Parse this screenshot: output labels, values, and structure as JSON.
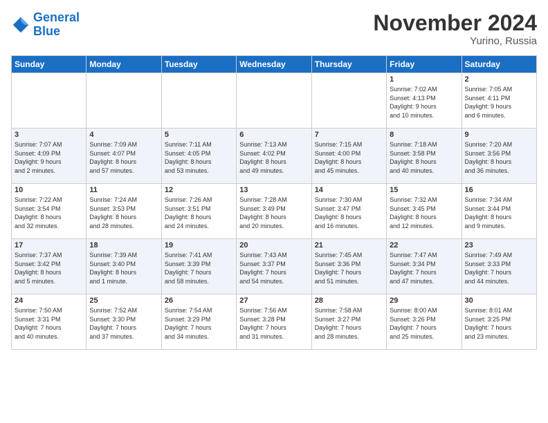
{
  "logo": {
    "line1": "General",
    "line2": "Blue"
  },
  "title": "November 2024",
  "location": "Yurino, Russia",
  "days_header": [
    "Sunday",
    "Monday",
    "Tuesday",
    "Wednesday",
    "Thursday",
    "Friday",
    "Saturday"
  ],
  "weeks": [
    [
      {
        "day": "",
        "info": ""
      },
      {
        "day": "",
        "info": ""
      },
      {
        "day": "",
        "info": ""
      },
      {
        "day": "",
        "info": ""
      },
      {
        "day": "",
        "info": ""
      },
      {
        "day": "1",
        "info": "Sunrise: 7:02 AM\nSunset: 4:13 PM\nDaylight: 9 hours\nand 10 minutes."
      },
      {
        "day": "2",
        "info": "Sunrise: 7:05 AM\nSunset: 4:11 PM\nDaylight: 9 hours\nand 6 minutes."
      }
    ],
    [
      {
        "day": "3",
        "info": "Sunrise: 7:07 AM\nSunset: 4:09 PM\nDaylight: 9 hours\nand 2 minutes."
      },
      {
        "day": "4",
        "info": "Sunrise: 7:09 AM\nSunset: 4:07 PM\nDaylight: 8 hours\nand 57 minutes."
      },
      {
        "day": "5",
        "info": "Sunrise: 7:11 AM\nSunset: 4:05 PM\nDaylight: 8 hours\nand 53 minutes."
      },
      {
        "day": "6",
        "info": "Sunrise: 7:13 AM\nSunset: 4:02 PM\nDaylight: 8 hours\nand 49 minutes."
      },
      {
        "day": "7",
        "info": "Sunrise: 7:15 AM\nSunset: 4:00 PM\nDaylight: 8 hours\nand 45 minutes."
      },
      {
        "day": "8",
        "info": "Sunrise: 7:18 AM\nSunset: 3:58 PM\nDaylight: 8 hours\nand 40 minutes."
      },
      {
        "day": "9",
        "info": "Sunrise: 7:20 AM\nSunset: 3:56 PM\nDaylight: 8 hours\nand 36 minutes."
      }
    ],
    [
      {
        "day": "10",
        "info": "Sunrise: 7:22 AM\nSunset: 3:54 PM\nDaylight: 8 hours\nand 32 minutes."
      },
      {
        "day": "11",
        "info": "Sunrise: 7:24 AM\nSunset: 3:53 PM\nDaylight: 8 hours\nand 28 minutes."
      },
      {
        "day": "12",
        "info": "Sunrise: 7:26 AM\nSunset: 3:51 PM\nDaylight: 8 hours\nand 24 minutes."
      },
      {
        "day": "13",
        "info": "Sunrise: 7:28 AM\nSunset: 3:49 PM\nDaylight: 8 hours\nand 20 minutes."
      },
      {
        "day": "14",
        "info": "Sunrise: 7:30 AM\nSunset: 3:47 PM\nDaylight: 8 hours\nand 16 minutes."
      },
      {
        "day": "15",
        "info": "Sunrise: 7:32 AM\nSunset: 3:45 PM\nDaylight: 8 hours\nand 12 minutes."
      },
      {
        "day": "16",
        "info": "Sunrise: 7:34 AM\nSunset: 3:44 PM\nDaylight: 8 hours\nand 9 minutes."
      }
    ],
    [
      {
        "day": "17",
        "info": "Sunrise: 7:37 AM\nSunset: 3:42 PM\nDaylight: 8 hours\nand 5 minutes."
      },
      {
        "day": "18",
        "info": "Sunrise: 7:39 AM\nSunset: 3:40 PM\nDaylight: 8 hours\nand 1 minute."
      },
      {
        "day": "19",
        "info": "Sunrise: 7:41 AM\nSunset: 3:39 PM\nDaylight: 7 hours\nand 58 minutes."
      },
      {
        "day": "20",
        "info": "Sunrise: 7:43 AM\nSunset: 3:37 PM\nDaylight: 7 hours\nand 54 minutes."
      },
      {
        "day": "21",
        "info": "Sunrise: 7:45 AM\nSunset: 3:36 PM\nDaylight: 7 hours\nand 51 minutes."
      },
      {
        "day": "22",
        "info": "Sunrise: 7:47 AM\nSunset: 3:34 PM\nDaylight: 7 hours\nand 47 minutes."
      },
      {
        "day": "23",
        "info": "Sunrise: 7:49 AM\nSunset: 3:33 PM\nDaylight: 7 hours\nand 44 minutes."
      }
    ],
    [
      {
        "day": "24",
        "info": "Sunrise: 7:50 AM\nSunset: 3:31 PM\nDaylight: 7 hours\nand 40 minutes."
      },
      {
        "day": "25",
        "info": "Sunrise: 7:52 AM\nSunset: 3:30 PM\nDaylight: 7 hours\nand 37 minutes."
      },
      {
        "day": "26",
        "info": "Sunrise: 7:54 AM\nSunset: 3:29 PM\nDaylight: 7 hours\nand 34 minutes."
      },
      {
        "day": "27",
        "info": "Sunrise: 7:56 AM\nSunset: 3:28 PM\nDaylight: 7 hours\nand 31 minutes."
      },
      {
        "day": "28",
        "info": "Sunrise: 7:58 AM\nSunset: 3:27 PM\nDaylight: 7 hours\nand 28 minutes."
      },
      {
        "day": "29",
        "info": "Sunrise: 8:00 AM\nSunset: 3:26 PM\nDaylight: 7 hours\nand 25 minutes."
      },
      {
        "day": "30",
        "info": "Sunrise: 8:01 AM\nSunset: 3:25 PM\nDaylight: 7 hours\nand 23 minutes."
      }
    ]
  ]
}
